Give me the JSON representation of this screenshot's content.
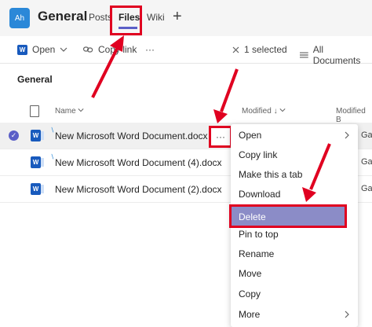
{
  "header": {
    "avatar": "Ah",
    "team": "General",
    "tabs": [
      {
        "label": "Posts"
      },
      {
        "label": "Files"
      },
      {
        "label": "Wiki"
      }
    ],
    "add": "+"
  },
  "toolbar": {
    "open": "Open",
    "copy_link": "Copy link",
    "more": "···",
    "selected": "1 selected",
    "all_documents": "All Documents"
  },
  "section": "General",
  "columns": {
    "name": "Name",
    "modified": "Modified",
    "modified_by": "Modified B"
  },
  "files": [
    {
      "name": "New Microsoft Word Document.docx",
      "by": "Ga",
      "selected": true
    },
    {
      "name": "New Microsoft Word Document (4).docx",
      "by": "Ga",
      "selected": false
    },
    {
      "name": "New Microsoft Word Document (2).docx",
      "by": "Ga",
      "selected": false
    }
  ],
  "row_more": "···",
  "context_menu": [
    {
      "label": "Open",
      "submenu": true
    },
    {
      "label": "Copy link"
    },
    {
      "label": "Make this a tab"
    },
    {
      "label": "Download"
    },
    {
      "label": "Delete",
      "highlighted": true
    },
    {
      "label": "Pin to top"
    },
    {
      "label": "Rename"
    },
    {
      "label": "Move"
    },
    {
      "label": "Copy"
    },
    {
      "label": "More",
      "submenu": true
    }
  ],
  "colors": {
    "accent": "#5b5fc7",
    "annotation": "#e00020",
    "word": "#185abd"
  }
}
